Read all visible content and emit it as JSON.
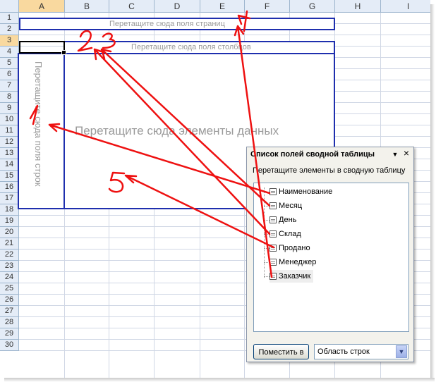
{
  "columns": [
    "A",
    "B",
    "C",
    "D",
    "E",
    "F",
    "G",
    "H",
    "I"
  ],
  "rows": [
    "1",
    "2",
    "3",
    "4",
    "5",
    "6",
    "7",
    "8",
    "9",
    "10",
    "11",
    "12",
    "13",
    "14",
    "15",
    "16",
    "17",
    "18",
    "19",
    "20",
    "21",
    "22",
    "23",
    "24",
    "25",
    "26",
    "27",
    "28",
    "29",
    "30"
  ],
  "pivot": {
    "page_area_text": "Перетащите сюда поля страниц",
    "column_area_text": "Перетащите сюда поля столбцов",
    "row_area_text": "Перетащите сюда поля строк",
    "data_area_text": "Перетащите сюда элементы данных"
  },
  "field_list": {
    "title": "Список полей сводной таблицы",
    "dropdown_glyph": "▼",
    "close_glyph": "×",
    "instruction": "Перетащите элементы в сводную таблицу",
    "fields": [
      "Наименование",
      "Месяц",
      "День",
      "Склад",
      "Продано",
      "Менеджер",
      "Заказчик"
    ],
    "place_button": "Поместить в",
    "area_select_value": "Область строк",
    "select_arrow": "▼"
  },
  "annotations": {
    "color": "#ee1111",
    "labels": [
      "1",
      "2",
      "3",
      "4",
      "5"
    ]
  },
  "colors": {
    "pivot_border": "#1f2fae",
    "header_bg": "#e4ecf7",
    "header_selected": "#f9d99f",
    "grid": "#d0d7e5"
  }
}
